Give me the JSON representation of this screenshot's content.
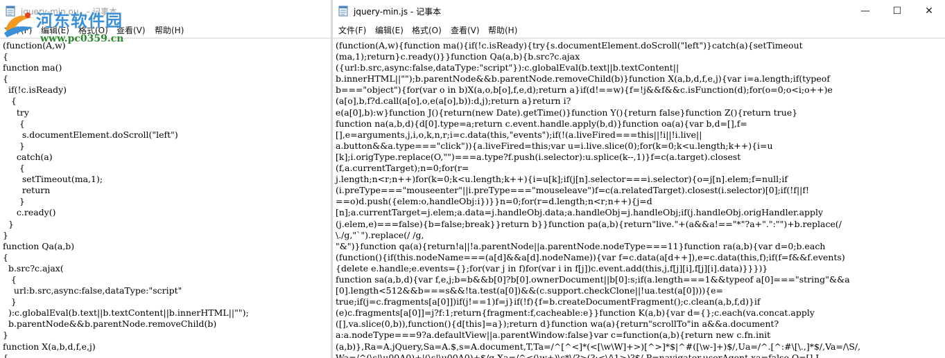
{
  "left_window": {
    "title": "jquery-min.ou...- 记事本",
    "menu": [
      "文件(F)",
      "编辑(E)",
      "格式(O)",
      "查看(V)",
      "帮助(H)"
    ],
    "code_lines": [
      "(function(A,w)",
      "{",
      "function ma()",
      "{",
      "  if(!c.isReady)",
      "   {",
      "     try",
      "      {",
      "       s.documentElement.doScroll(\"left\")",
      "      }",
      "     catch(a)",
      "      {",
      "       setTimeout(ma,1);",
      "       return",
      "      }",
      "     c.ready()",
      "  }",
      "}",
      "function Qa(a,b)",
      "{",
      "  b.src?c.ajax(",
      "   {",
      "    url:b.src,async:false,dataType:\"script\"",
      "   }",
      "  ):c.globalEval(b.text||b.textContent||b.innerHTML||\"\");",
      "  b.parentNode&&b.parentNode.removeChild(b)",
      "}",
      "function X(a,b,d,f,e,j)",
      "{"
    ]
  },
  "right_window": {
    "title": "jquery-min.js - 记事本",
    "menu": [
      "文件(F)",
      "编辑(E)",
      "格式(O)",
      "查看(V)",
      "帮助(H)"
    ],
    "controls": {
      "minimize": "—",
      "maximize": "☐",
      "close": "✕"
    },
    "code_lines": [
      "(function(A,w){function ma(){if(!c.isReady){try{s.documentElement.doScroll(\"left\")}catch(a){setTimeout",
      "(ma,1);return}c.ready()}}function Qa(a,b){b.src?c.ajax",
      "({url:b.src,async:false,dataType:\"script\"}):c.globalEval(b.text||b.textContent||",
      "b.innerHTML||\"\");b.parentNode&&b.parentNode.removeChild(b)}function X(a,b,d,f,e,j){var i=a.length;if(typeof",
      "b===\"object\"){for(var o in b)X(a,o,b[o],f,e,d);return a}if(d!==w){f=!j&&f&&c.isFunction(d);for(o=0;o<i;o++)e",
      "(a[o],b,f?d.call(a[o],o,e(a[o],b)):d,j);return a}return i?",
      "e(a[0],b):w}function J(){return(new Date).getTime()}function Y(){return false}function Z(){return true}",
      "function na(a,b,d){d[0].type=a;return c.event.handle.apply(b,d)}function oa(a){var b,d=[],f=",
      "[],e=arguments,j,i,o,k,n,r;i=c.data(this,\"events\");if(!(a.liveFired===this||!i||!i.live||",
      "a.button&&a.type===\"click\")){a.liveFired=this;var u=i.live.slice(0);for(k=0;k<u.length;k++){i=u",
      "[k];i.origType.replace(O,\"\")===a.type?f.push(i.selector):u.splice(k--,1)}f=c(a.target).closest",
      "(f,a.currentTarget);n=0;for(r=",
      "j.length;n<r;n++)for(k=0;k<u.length;k++){i=u[k];if(j[n].selector===i.selector){o=j[n].elem;f=null;if",
      "(i.preType===\"mouseenter\"||i.preType===\"mouseleave\")f=c(a.relatedTarget).closest(i.selector)[0];if(!f||f!",
      "==o)d.push({elem:o,handleObj:i})}}n=0;for(r=d.length;n<r;n++){j=d",
      "[n];a.currentTarget=j.elem;a.data=j.handleObj.data;a.handleObj=j.handleObj;if(j.handleObj.origHandler.apply",
      "(j.elem,e)===false){b=false;break}}return b}}function pa(a,b){return\"live.\"+(a&&a!==\"*\"?a+\".\":\"\")+b.replace(/",
      "\\./g,\"`\").replace(/ /g,",
      "\"&\")}function qa(a){return!a||!a.parentNode||a.parentNode.nodeType===11}function ra(a,b){var d=0;b.each",
      "(function(){if(this.nodeName===(a[d]&&a[d].nodeName)){var f=c.data(a[d++]),e=c.data(this,f);if(f=f&&f.events)",
      "{delete e.handle;e.events={};for(var j in f)for(var i in f[j])c.event.add(this,j,f[j][i],f[j][i].data)}}})}",
      "function sa(a,b,d){var f,e,j;b=b&&b[0]?b[0].ownerDocument||b[0]:s;if(a.length===1&&typeof a[0]===\"string\"&&a",
      "[0].length<512&&b===s&&!ta.test(a[0])&&(c.support.checkClone||!ua.test(a[0]))){e=",
      "true;if(j=c.fragments[a[0]])if(j!==1)f=j}if(!f){f=b.createDocumentFragment();c.clean(a,b,f,d)}if",
      "(e)c.fragments[a[0]]=j?f:1;return{fragment:f,cacheable:e}}function K(a,b){var d={};c.each(va.concat.apply",
      "([],va.slice(0,b)),function(){d[this]=a});return d}function wa(a){return\"scrollTo\"in a&&a.document?",
      "a:a.nodeType===9?a.defaultView||a.parentWindow:false}var c=function(a,b){return new c.fn.init",
      "(a,b)},Ra=A.jQuery,Sa=A.$,s=A.document,T,Ta=/^[^<]*(<[\\w\\W]+>)[^>]*$|^#([\\w-]+)$/,Ua=/^.[^:#\\[\\.,]*$/,Va=/\\S/,",
      "Wa=/^(\\s|\\u00A0)+|(\\s|\\u00A0)+$/g,Xa=/^<(\\w+)\\s*\\/?>(?:<\\/\\1>)?$/,P=navigator.userAgent,xa=false,Q=[],L,"
    ]
  },
  "watermark": {
    "title": "河东软件园",
    "url": "www.pc0359.cn"
  },
  "icons": {
    "notepad": "notepad-icon",
    "logo": "watermark-logo-icon"
  }
}
